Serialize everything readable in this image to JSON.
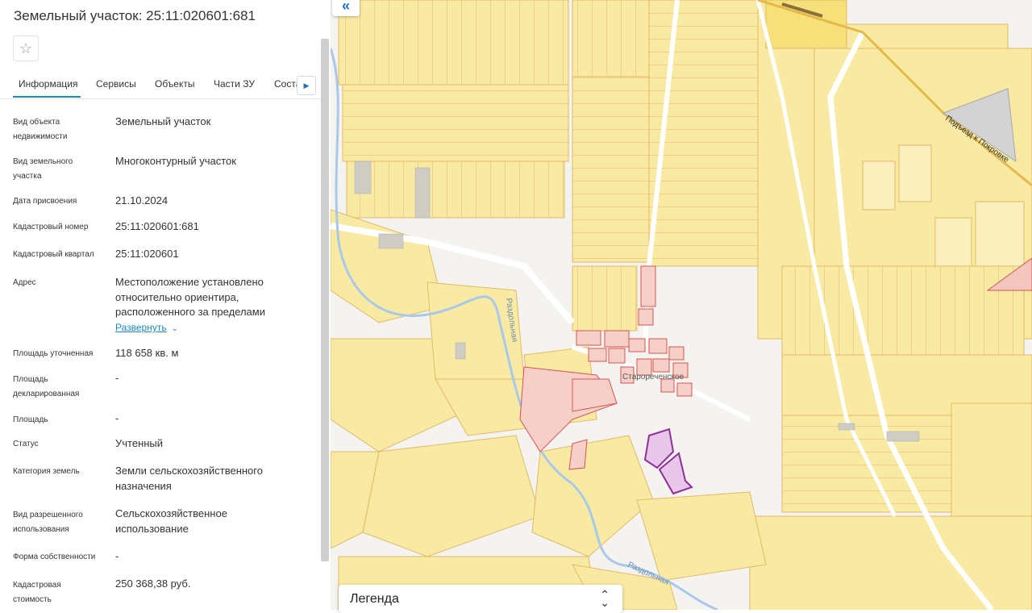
{
  "panel": {
    "title": "Земельный участок: 25:11:020601:681",
    "tabs": [
      {
        "label": "Информация"
      },
      {
        "label": "Сервисы"
      },
      {
        "label": "Объекты"
      },
      {
        "label": "Части ЗУ"
      },
      {
        "label": "Соста..."
      }
    ],
    "fields": [
      {
        "label": "Вид объекта недвижимости",
        "value": "Земельный участок"
      },
      {
        "label": "Вид земельного участка",
        "value": "Многоконтурный участок"
      },
      {
        "label": "Дата присвоения",
        "value": "21.10.2024"
      },
      {
        "label": "Кадастровый номер",
        "value": "25:11:020601:681"
      },
      {
        "label": "Кадастровый квартал",
        "value": "25:11:020601"
      },
      {
        "label": "Адрес",
        "value": "Местоположение установлено относительно ориентира, расположенного за пределами"
      },
      {
        "label": "Площадь уточненная",
        "value": "118 658 кв. м"
      },
      {
        "label": "Площадь декларированная",
        "value": "-"
      },
      {
        "label": "Площадь",
        "value": "-"
      },
      {
        "label": "Статус",
        "value": "Учтенный"
      },
      {
        "label": "Категория земель",
        "value": "Земли сельскохозяйственного назначения"
      },
      {
        "label": "Вид разрешенного использования",
        "value": "Сельскохозяйственное использование"
      },
      {
        "label": "Форма собственности",
        "value": "-"
      },
      {
        "label": "Кадастровая стоимость",
        "value": "250 368,38 руб."
      }
    ],
    "expand_label": "Развернуть"
  },
  "map": {
    "legend_title": "Легенда",
    "labels": {
      "village": "Старореченское",
      "river1": "Раздольная",
      "river2": "Раздольная",
      "road": "Подъезд к Покровке"
    },
    "colors": {
      "parcel_fill": "#f8e9a3",
      "parcel_stroke": "#e3b967",
      "water": "#a9c9ea",
      "highlight": "#8e2f9a",
      "red_parcels": "#d9534f",
      "accent": "#1e88c8"
    }
  }
}
